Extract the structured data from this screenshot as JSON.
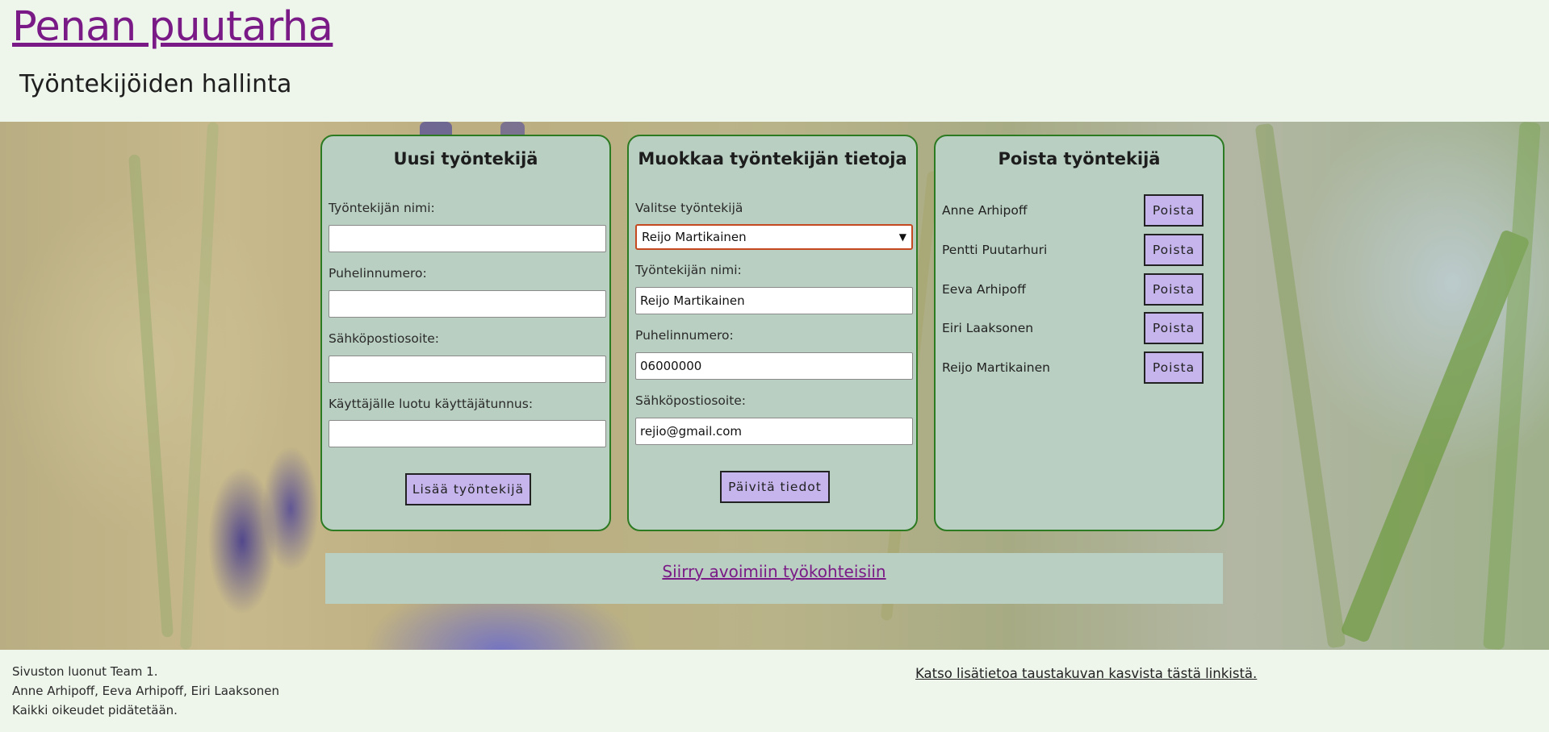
{
  "header": {
    "site_title": "Penan puutarha",
    "page_heading": "Työntekijöiden hallinta"
  },
  "new_employee": {
    "title": "Uusi työntekijä",
    "name_label": "Työntekijän nimi:",
    "name_value": "",
    "phone_label": "Puhelinnumero:",
    "phone_value": "",
    "email_label": "Sähköpostiosoite:",
    "email_value": "",
    "username_label": "Käyttäjälle luotu käyttäjätunnus:",
    "username_value": "",
    "submit_label": "Lisää työntekijä"
  },
  "edit_employee": {
    "title": "Muokkaa työntekijän tietoja",
    "select_label": "Valitse työntekijä",
    "selected_employee": "Reijo Martikainen",
    "name_label": "Työntekijän nimi:",
    "name_value": "Reijo Martikainen",
    "phone_label": "Puhelinnumero:",
    "phone_value": "06000000",
    "email_label": "Sähköpostiosoite:",
    "email_value": "rejio@gmail.com",
    "submit_label": "Päivitä tiedot"
  },
  "delete_employee": {
    "title": "Poista työntekijä",
    "button_label": "Poista",
    "employees": [
      "Anne Arhipoff",
      "Pentti Puutarhuri",
      "Eeva Arhipoff",
      "Eiri Laaksonen",
      "Reijo Martikainen"
    ]
  },
  "nav": {
    "open_jobs_link": "Siirry avoimiin työkohteisiin"
  },
  "footer": {
    "lines": [
      "Sivuston luonut Team 1.",
      "Anne Arhipoff, Eeva Arhipoff, Eiri Laaksonen",
      "Kaikki oikeudet pidätetään."
    ],
    "background_info_link": "Katso lisätietoa taustakuvan kasvista tästä linkistä."
  },
  "colors": {
    "page_background": "#eef6ec",
    "panel_background": "#b9cfc2",
    "panel_border": "#2c7a22",
    "button_background": "#c6b5ed",
    "link_color": "#7a1a86",
    "select_focus_border": "#c4491e"
  },
  "icons": {
    "select_caret": "chevron-down-icon"
  }
}
